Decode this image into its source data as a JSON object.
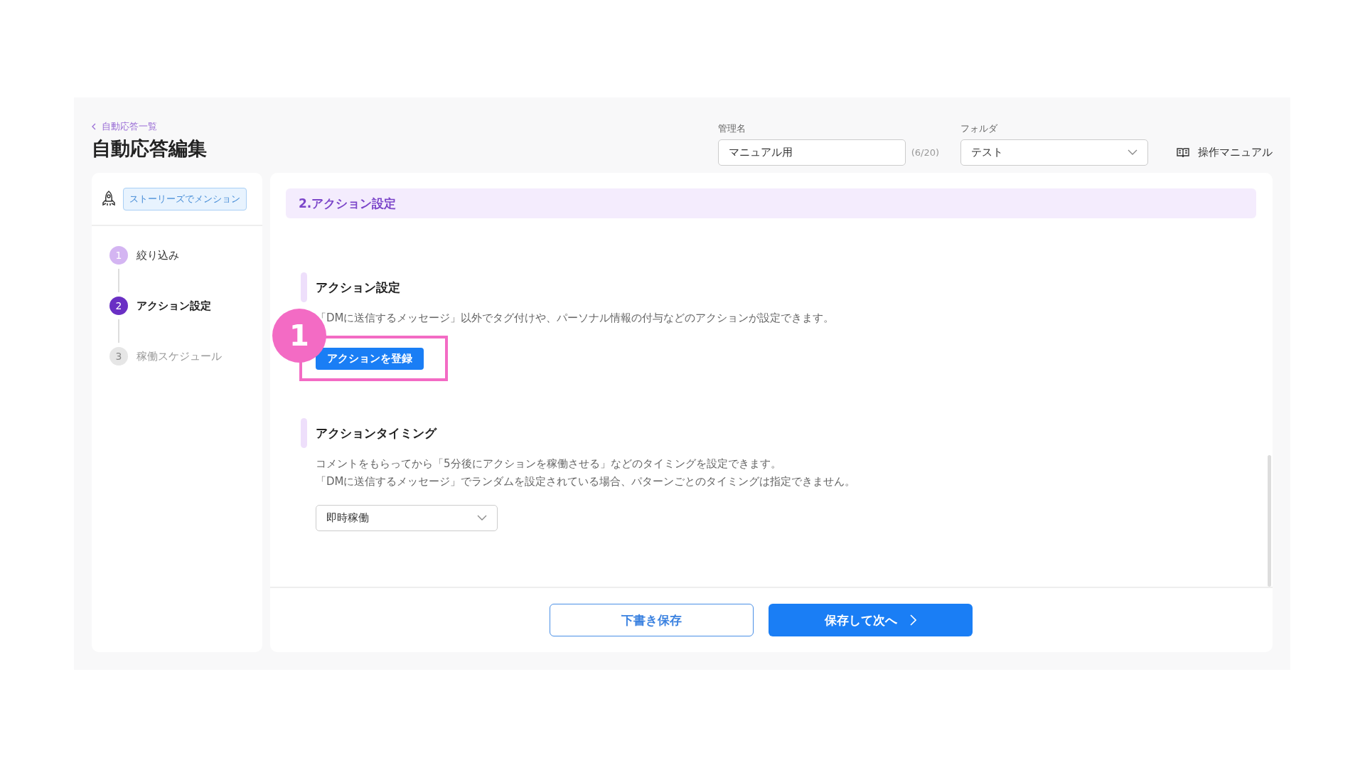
{
  "header": {
    "back_link": "自動応答一覧",
    "title": "自動応答編集",
    "name_field": {
      "label": "管理名",
      "value": "マニュアル用",
      "counter": "(6/20)"
    },
    "folder_field": {
      "label": "フォルダ",
      "value": "テスト"
    },
    "manual_link": "操作マニュアル"
  },
  "sidebar": {
    "trigger_tag": "ストーリーズでメンション",
    "steps": [
      {
        "number": "1",
        "label": "絞り込み",
        "completed": true,
        "selected": false
      },
      {
        "number": "2",
        "label": "アクション設定",
        "completed": false,
        "selected": true
      },
      {
        "number": "3",
        "label": "稼働スケジュール",
        "completed": false,
        "selected": false
      }
    ]
  },
  "main": {
    "section_title": "2.アクション設定",
    "action_section": {
      "heading": "アクション設定",
      "description": "「DMに送信するメッセージ」以外でタグ付けや、パーソナル情報の付与などのアクションが設定できます。",
      "button": "アクションを登録"
    },
    "annotation": {
      "label": "1"
    },
    "timing_section": {
      "heading": "アクションタイミング",
      "description_lines": [
        "コメントをもらってから「5分後にアクションを稼働させる」などのタイミングを設定できます。",
        "「DMに送信するメッセージ」でランダムを設定されている場合、パターンごとのタイミングは指定できません。"
      ],
      "select_value": "即時稼働"
    },
    "footer": {
      "draft_button": "下書き保存",
      "next_button": "保存して次へ"
    }
  }
}
